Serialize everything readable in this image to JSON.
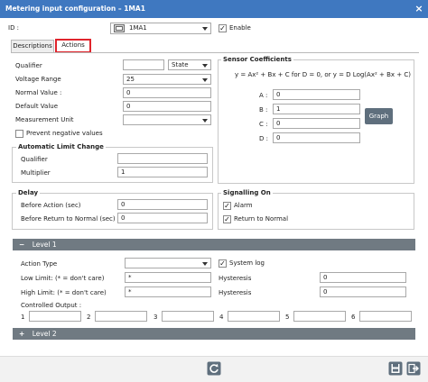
{
  "window": {
    "title": "Metering input configuration – 1MA1",
    "close_glyph": "×"
  },
  "id_row": {
    "label": "ID :",
    "value": "1MA1",
    "enable_label": "Enable",
    "enable_checked": true
  },
  "tabs": [
    {
      "label": "Descriptions"
    },
    {
      "label": "Actions"
    }
  ],
  "form": {
    "qualifier_label": "Qualifier",
    "qualifier_value": "",
    "state_select": "State",
    "voltage_range_label": "Voltage Range",
    "voltage_range_value": "25",
    "normal_value_label": "Normal Value :",
    "normal_value": "0",
    "default_value_label": "Default Value",
    "default_value": "0",
    "measurement_unit_label": "Measurement Unit",
    "measurement_unit_value": "",
    "prevent_negative_label": "Prevent negative values",
    "prevent_negative_checked": false
  },
  "auto_limit": {
    "legend": "Automatic Limit Change",
    "qualifier_label": "Qualifier",
    "qualifier_value": "",
    "multiplier_label": "Multiplier",
    "multiplier_value": "1"
  },
  "sensor": {
    "legend": "Sensor Coefficients",
    "formula": "y = Ax² + Bx + C for D = 0, or y = D Log(Ax² + Bx + C)",
    "a_label": "A :",
    "a_value": "0",
    "b_label": "B :",
    "b_value": "1",
    "c_label": "C :",
    "c_value": "0",
    "d_label": "D :",
    "d_value": "0",
    "graph_button": "Graph"
  },
  "delay": {
    "legend": "Delay",
    "before_action_label": "Before Action (sec)",
    "before_action_value": "0",
    "before_return_label": "Before Return to Normal (sec)",
    "before_return_value": "0"
  },
  "signalling": {
    "legend": "Signalling On",
    "alarm_label": "Alarm",
    "alarm_checked": true,
    "return_label": "Return to Normal",
    "return_checked": true
  },
  "level1": {
    "header": "Level 1",
    "toggle_glyph": "−",
    "action_type_label": "Action Type",
    "action_type_value": "",
    "system_log_label": "System log",
    "system_log_checked": true,
    "low_limit_label": "Low Limit: (* = don't care)",
    "low_limit_value": "*",
    "high_limit_label": "High Limit: (* = don't care)",
    "high_limit_value": "*",
    "hysteresis_label": "Hysteresis",
    "hysteresis_low_value": "0",
    "hysteresis_high_value": "0",
    "controlled_output_label": "Controlled Output :",
    "outputs": [
      {
        "n": "1",
        "value": ""
      },
      {
        "n": "2",
        "value": ""
      },
      {
        "n": "3",
        "value": ""
      },
      {
        "n": "4",
        "value": ""
      },
      {
        "n": "5",
        "value": ""
      },
      {
        "n": "6",
        "value": ""
      }
    ]
  },
  "level2": {
    "header": "Level 2",
    "toggle_glyph": "+"
  },
  "check_glyph": "✓"
}
